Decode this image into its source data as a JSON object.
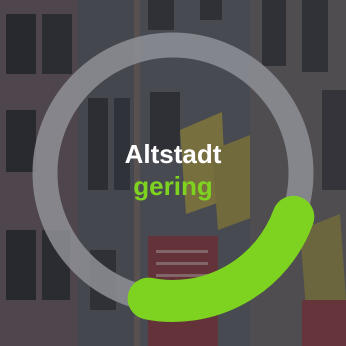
{
  "location": {
    "name": "Altstadt"
  },
  "level": {
    "label": "gering",
    "fraction": 0.25
  },
  "colors": {
    "ring_track": "#8e9196",
    "ring_active": "#7ed321",
    "label_text": "#ffffff",
    "level_text": "#7ed321"
  }
}
